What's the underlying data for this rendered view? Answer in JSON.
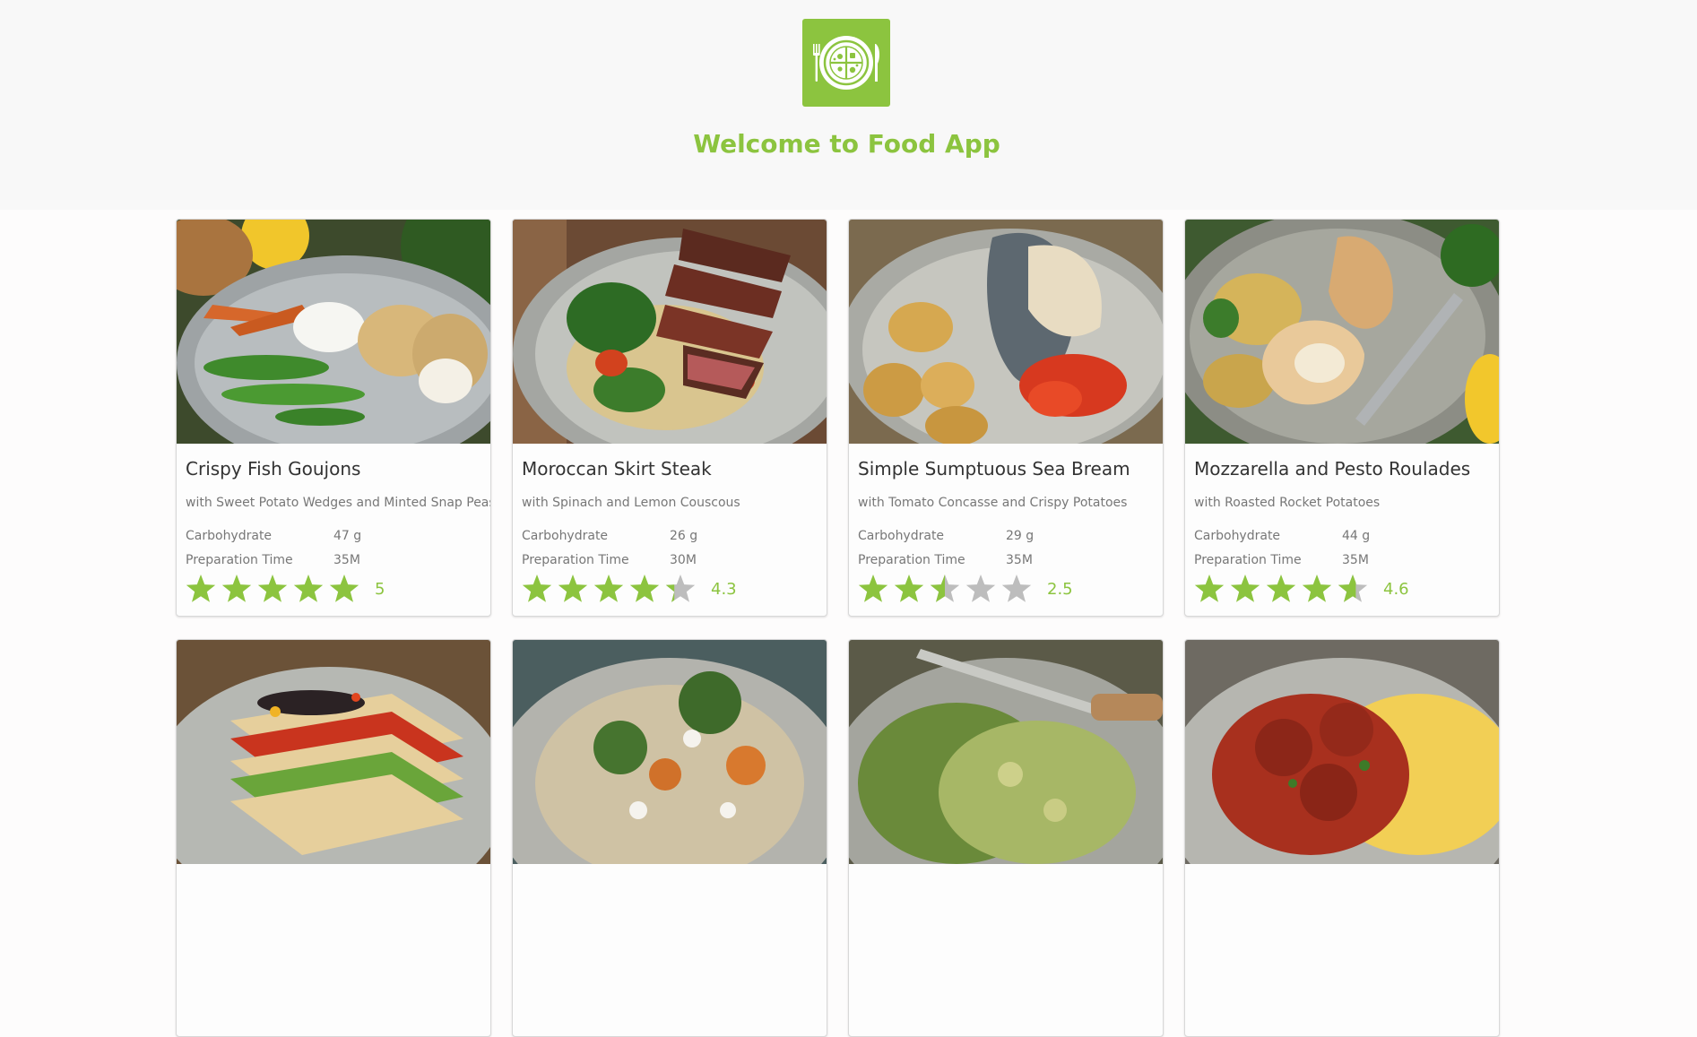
{
  "header": {
    "title": "Welcome to Food App",
    "accent_color": "#8cc43f",
    "logo_icon": "plate-cutlery-icon"
  },
  "colors": {
    "star_on": "#8cc43f",
    "star_off": "#bdbdbd"
  },
  "recipes": [
    {
      "name": "Crispy Fish Goujons",
      "subtitle": "with Sweet Potato Wedges and Minted Snap Peas",
      "carb_label": "Carbohydrate",
      "carb_value": "47 g",
      "prep_label": "Preparation Time",
      "prep_value": "35M",
      "rating": 5,
      "rating_label": "5",
      "photo": "fish-goujons-photo"
    },
    {
      "name": "Moroccan Skirt Steak",
      "subtitle": "with Spinach and Lemon Couscous",
      "carb_label": "Carbohydrate",
      "carb_value": "26 g",
      "prep_label": "Preparation Time",
      "prep_value": "30M",
      "rating": 4.3,
      "rating_label": "4.3",
      "photo": "skirt-steak-photo"
    },
    {
      "name": "Simple Sumptuous Sea Bream",
      "subtitle": "with Tomato Concasse and Crispy Potatoes",
      "carb_label": "Carbohydrate",
      "carb_value": "29 g",
      "prep_label": "Preparation Time",
      "prep_value": "35M",
      "rating": 2.5,
      "rating_label": "2.5",
      "photo": "sea-bream-photo"
    },
    {
      "name": "Mozzarella and Pesto Roulades",
      "subtitle": "with Roasted Rocket Potatoes",
      "carb_label": "Carbohydrate",
      "carb_value": "44 g",
      "prep_label": "Preparation Time",
      "prep_value": "35M",
      "rating": 4.6,
      "rating_label": "4.6",
      "photo": "chicken-roulades-photo"
    },
    {
      "photo": "tortilla-stack-photo"
    },
    {
      "photo": "roasted-veg-rice-photo"
    },
    {
      "photo": "green-gnocchi-photo"
    },
    {
      "photo": "meatballs-polenta-photo"
    }
  ]
}
